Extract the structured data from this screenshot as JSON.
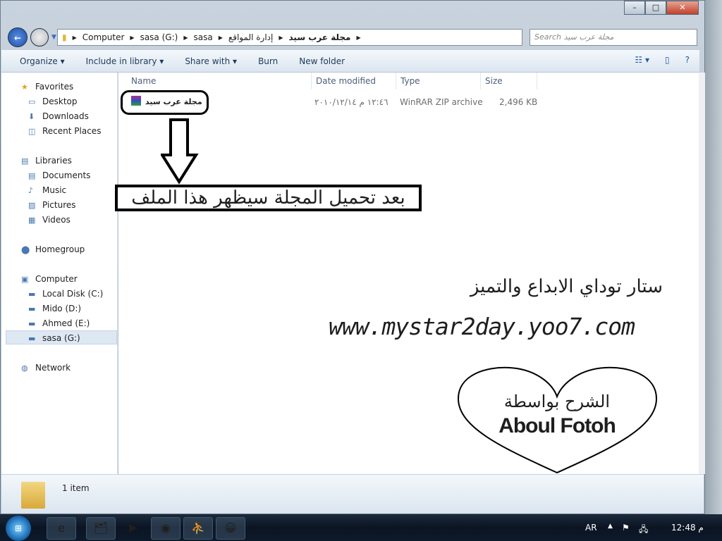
{
  "window": {
    "controls": [
      "–",
      "□",
      "✕"
    ]
  },
  "address": {
    "crumbs": [
      "Computer",
      "sasa (G:)",
      "sasa",
      "إدارة المواقع",
      "مجلة عرب سيد"
    ],
    "search_placeholder": "Search مجلة عرب سيد"
  },
  "toolbar": {
    "items": [
      "Organize ▾",
      "Include in library ▾",
      "Share with ▾",
      "Burn",
      "New folder"
    ],
    "right": [
      "☷ ▾",
      "▯",
      "?"
    ]
  },
  "sidebar": {
    "items": [
      {
        "label": "Favorites",
        "icon": "star-icon",
        "h": true
      },
      {
        "label": "Desktop",
        "icon": "desktop-icon"
      },
      {
        "label": "Downloads",
        "icon": "downloads-icon"
      },
      {
        "label": "Recent Places",
        "icon": "recent-places-icon"
      },
      {
        "label": "Libraries",
        "icon": "library-icon",
        "h": true
      },
      {
        "label": "Documents",
        "icon": "documents-icon"
      },
      {
        "label": "Music",
        "icon": "music-icon"
      },
      {
        "label": "Pictures",
        "icon": "pictures-icon"
      },
      {
        "label": "Videos",
        "icon": "videos-icon"
      },
      {
        "label": "Homegroup",
        "icon": "homegroup-icon",
        "h": true
      },
      {
        "label": "Computer",
        "icon": "computer-icon",
        "h": true
      },
      {
        "label": "Local Disk (C:)",
        "icon": "drive-icon"
      },
      {
        "label": "Mido (D:)",
        "icon": "drive-icon"
      },
      {
        "label": "Ahmed (E:)",
        "icon": "drive-icon"
      },
      {
        "label": "sasa (G:)",
        "icon": "drive-icon"
      },
      {
        "label": "Network",
        "icon": "network-icon",
        "h": true
      }
    ]
  },
  "columns": [
    "Name",
    "Date modified",
    "Type",
    "Size"
  ],
  "file": {
    "name": "مجلة عرب سيد",
    "date": "١٢:٤٦ م ٢٠١٠/١٢/١٤",
    "type": "WinRAR ZIP archive",
    "size": "2,496 KB"
  },
  "status": {
    "count": "1 item"
  },
  "annotations": {
    "caption": "بعد تحميل المجلة سيظهر هذا الملف",
    "site_name": "ستار توداي الابداع والتميز",
    "url": "www.mystar2day.yoo7.com",
    "by": "الشرح بواسطة",
    "author": "Aboul Fotoh"
  },
  "taskbar": {
    "apps": [
      "e",
      "🗂",
      "▶",
      "◉",
      "⛹",
      "😀"
    ],
    "lang": "AR",
    "time": "12:48 م"
  }
}
